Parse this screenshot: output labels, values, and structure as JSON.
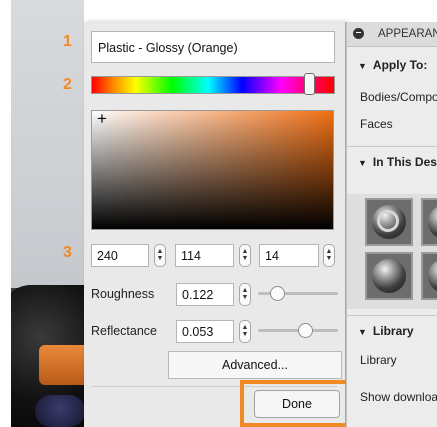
{
  "callouts": [
    "1",
    "2",
    "3"
  ],
  "material_name": "Plastic - Glossy (Orange)",
  "color": {
    "r": "240",
    "g": "114",
    "b": "14",
    "hex": "#f0720e"
  },
  "properties": {
    "roughness_label": "Roughness",
    "roughness_value": "0.122",
    "reflectance_label": "Reflectance",
    "reflectance_value": "0.053"
  },
  "buttons": {
    "advanced": "Advanced...",
    "done": "Done"
  },
  "panel": {
    "title": "APPEARANCE",
    "apply_to_heading": "Apply To:",
    "apply_to_items": [
      "Bodies/Components",
      "Faces"
    ],
    "in_this_design_heading": "In This Design",
    "library_heading": "Library",
    "library_item": "Library",
    "show_downloads": "Show downloads"
  },
  "colors": {
    "accent": "#f08a24",
    "selected_color": "#f0720e"
  },
  "icons": [
    "plus-crosshair-icon",
    "stepper-icon",
    "collapse-circle-icon",
    "disclosure-triangle-icon"
  ]
}
